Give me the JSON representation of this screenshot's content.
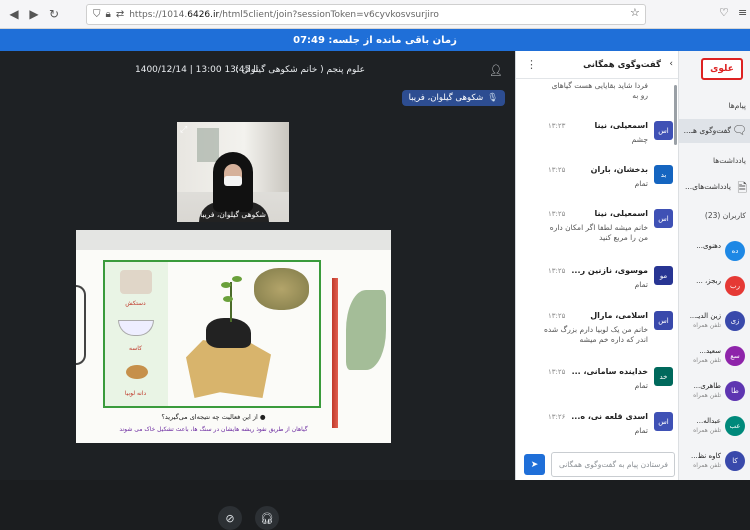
{
  "browser": {
    "url_prefix": "https://1014.",
    "url_domain": "6426.ir",
    "url_suffix": "/html5client/join?sessionToken=v6cyvkosvsurjiro"
  },
  "timer": {
    "text": "زمان باقی مانده از جلسه: 07:49"
  },
  "stage": {
    "session_title": "علوم پنجم ( خانم شکوهی گیلوان )",
    "session_time": "1400/12/14 | 13:00 تا 13:45",
    "presenter_chip": "شکوهی گیلوان، فریبا",
    "webcam_name": "شکوهی گیلوان، فریبا",
    "slide": {
      "label_gloves": "دستکش",
      "label_bowl": "کاسه",
      "label_seed": "دانه لوبیا",
      "question": "● از این فعالیت چه نتیجه‌ای می‌گیرید؟",
      "answer": "گیاهان از طریق نفوذ ریشه هایشان در سنگ ها، باعث تشکیل خاک می شوند"
    }
  },
  "chat": {
    "title": "گفت‌وگوی همگانی",
    "top_text": "فردا شاید بقایایی هست گیاهای رو به",
    "input_placeholder": "فرستادن پیام به گفت‌وگوی همگانی",
    "messages": [
      {
        "initials": "اس",
        "name": "اسمعیلی، نینا",
        "time": "۱۳:۲۳",
        "text": "چشم",
        "color": "#3f51b5"
      },
      {
        "initials": "بد",
        "name": "بدخشان، باران",
        "time": "۱۳:۲۵",
        "text": "تمام",
        "color": "#1565c0"
      },
      {
        "initials": "اس",
        "name": "اسمعیلی، نینا",
        "time": "۱۳:۲۵",
        "text": "خانم میشه لطفا اگر امکان داره من را مربع کنید",
        "color": "#3f51b5"
      },
      {
        "initials": "مو",
        "name": "موسوی، نازنین ر...",
        "time": "۱۳:۲۵",
        "text": "تمام",
        "color": "#283593"
      },
      {
        "initials": "اس",
        "name": "اسلامی، مارال",
        "time": "۱۳:۲۵",
        "text": "خانم من یک لوبیا دارم بزرگ شده اندر که داره خم میشه",
        "color": "#3949ab"
      },
      {
        "initials": "خد",
        "name": "خداینده سامانی، ...",
        "time": "۱۳:۲۵",
        "text": "تمام",
        "color": "#00695c"
      },
      {
        "initials": "اس",
        "name": "اسدی قلعه نی، ه...",
        "time": "۱۳:۲۶",
        "text": "تمام",
        "color": "#3f51b5"
      }
    ]
  },
  "sidebar": {
    "logo": "علوی",
    "messages_heading": "پیام‌ها",
    "chat_item": "گفت‌وگوی هـ...",
    "notes_heading": "یادداشت‌ها",
    "notes_item": "یادداشت‌های...",
    "users_heading": "کاربران (23)",
    "users": [
      {
        "initials": "ده",
        "name": "دهنوی...",
        "status": "",
        "color": "#1e88e5"
      },
      {
        "initials": "رب",
        "name": "ربجز، ...",
        "status": "",
        "color": "#e53935"
      },
      {
        "initials": "زی",
        "name": "زین الدیـ...",
        "status": "تلفن همراه",
        "color": "#3949ab"
      },
      {
        "initials": "سع",
        "name": "سعید...",
        "status": "تلفن همراه",
        "color": "#8e24aa"
      },
      {
        "initials": "طا",
        "name": "طاهری...",
        "status": "تلفن همراه",
        "color": "#5e35b1"
      },
      {
        "initials": "عب",
        "name": "عبداله...",
        "status": "تلفن همراه",
        "color": "#00897b"
      },
      {
        "initials": "کا",
        "name": "کاوه نظ...",
        "status": "تلفن همراه",
        "color": "#3949ab"
      }
    ]
  }
}
